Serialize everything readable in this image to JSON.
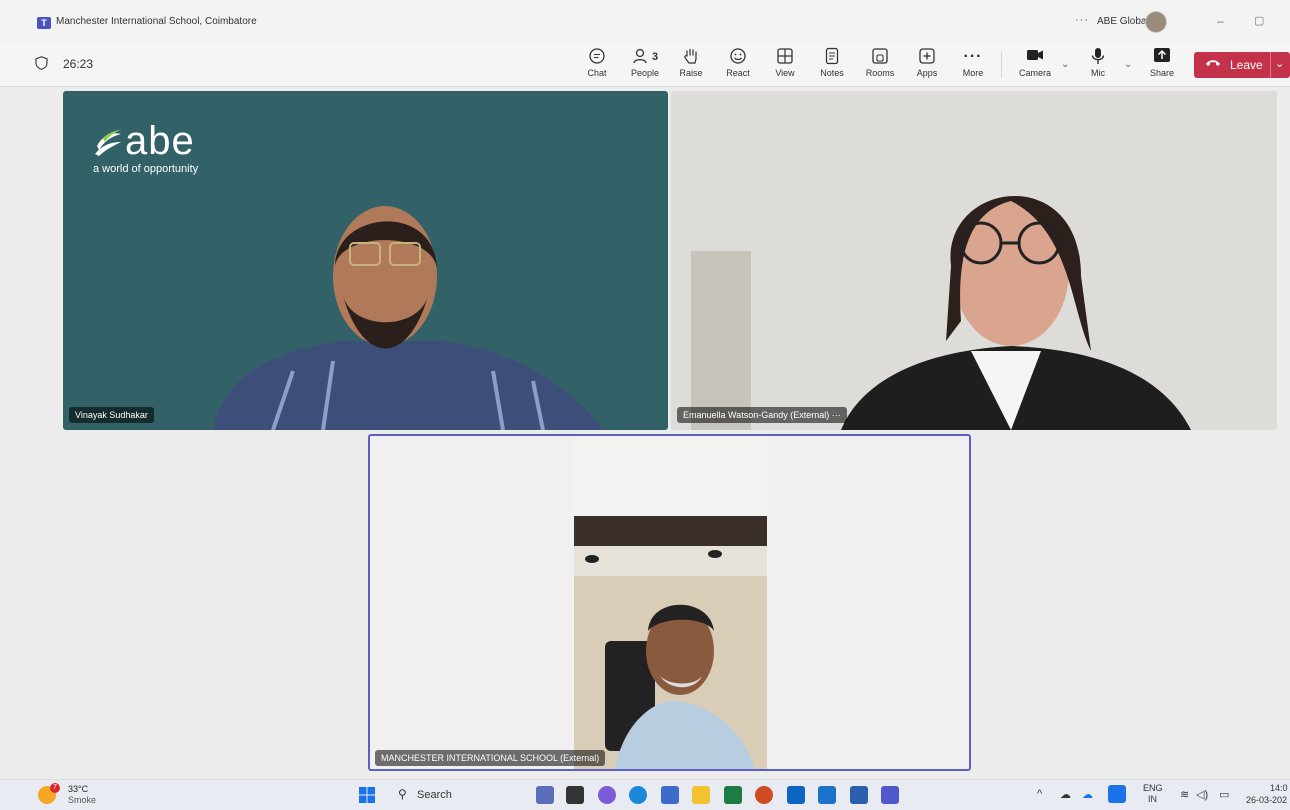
{
  "window": {
    "title": "Manchester International School, Coimbatore",
    "more": "···",
    "org": "ABE Global Ltd",
    "minimize": "–",
    "restore": "▢"
  },
  "toolbar": {
    "timer": "26:23",
    "buttons": {
      "chat": "Chat",
      "people": "People",
      "people_count": "3",
      "raise": "Raise",
      "react": "React",
      "view": "View",
      "notes": "Notes",
      "rooms": "Rooms",
      "apps": "Apps",
      "more": "More",
      "camera": "Camera",
      "mic": "Mic",
      "share": "Share"
    },
    "leave": "Leave"
  },
  "tiles": {
    "tile1": {
      "name": "Vinayak Sudhakar",
      "logo": "abe",
      "tagline": "a world of opportunity"
    },
    "tile2": {
      "name": "Emanuella Watson-Gandy (External)",
      "more": "···"
    },
    "tile3": {
      "name": "MANCHESTER INTERNATIONAL SCHOOL (External)"
    }
  },
  "taskbar": {
    "weather_temp": "33°C",
    "weather_desc": "Smoke",
    "weather_badge": "7",
    "search": "Search",
    "lang1": "ENG",
    "lang2": "IN",
    "time": "14:0",
    "date": "26-03-202"
  },
  "colors": {
    "accent": "#5b5fc7",
    "leave": "#c4314b",
    "abe_background": "#326167"
  }
}
